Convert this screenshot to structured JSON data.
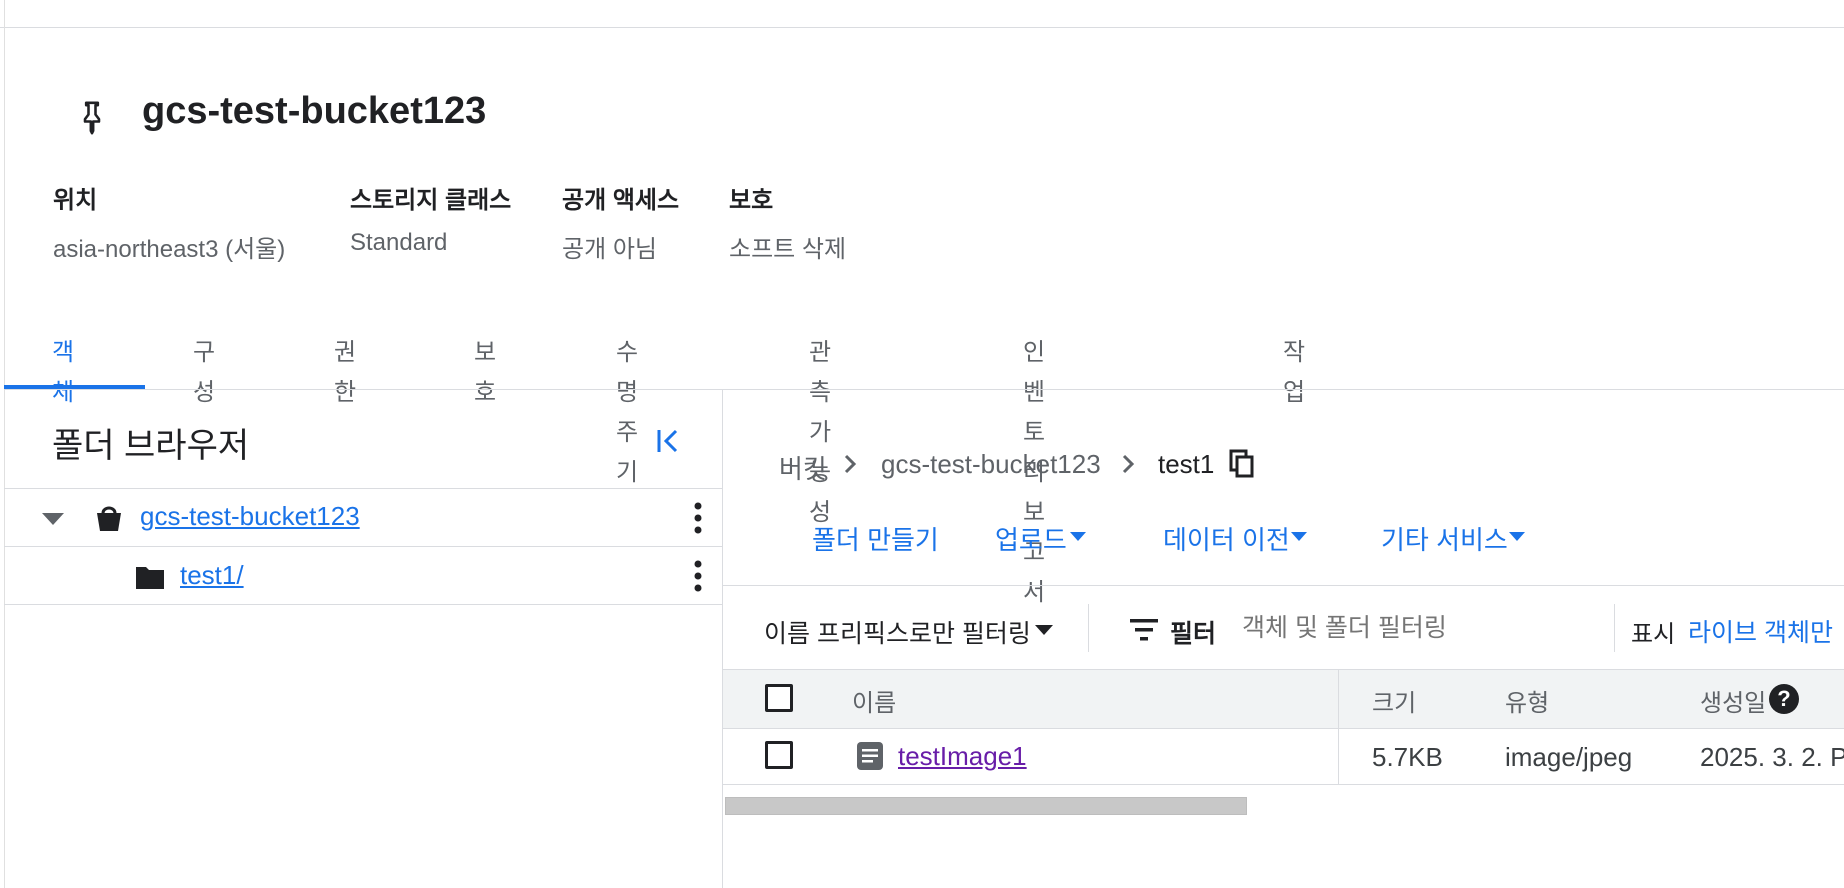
{
  "bucket": {
    "name": "gcs-test-bucket123"
  },
  "meta": [
    {
      "label": "위치",
      "value": "asia-northeast3 (서울)"
    },
    {
      "label": "스토리지 클래스",
      "value": "Standard"
    },
    {
      "label": "공개 액세스",
      "value": "공개 아님"
    },
    {
      "label": "보호",
      "value": "소프트 삭제"
    }
  ],
  "tabs": [
    "객체",
    "구성",
    "권한",
    "보호",
    "수명 주기",
    "관측 가능성",
    "인벤토리 보고서",
    "작업"
  ],
  "folder_browser": {
    "title": "폴더 브라우저",
    "tree": [
      {
        "label": "gcs-test-bucket123"
      },
      {
        "label": "test1/"
      }
    ]
  },
  "breadcrumb": [
    "버킷",
    "gcs-test-bucket123",
    "test1"
  ],
  "actions": {
    "create_folder": "폴더 만들기",
    "upload": "업로드",
    "transfer": "데이터 이전",
    "other": "기타 서비스"
  },
  "filter": {
    "prefix_mode": "이름 프리픽스로만 필터링",
    "filter_label": "필터",
    "placeholder": "객체 및 폴더 필터링",
    "show_label": "표시",
    "show_value": "라이브 객체만"
  },
  "table": {
    "headers": {
      "name": "이름",
      "size": "크기",
      "type": "유형",
      "created": "생성일"
    },
    "rows": [
      {
        "name": "testImage1",
        "size": "5.7KB",
        "type": "image/jpeg",
        "created": "2025. 3. 2. P"
      }
    ]
  },
  "colors": {
    "accent": "#1a73e8",
    "visited_link": "#681da8"
  }
}
